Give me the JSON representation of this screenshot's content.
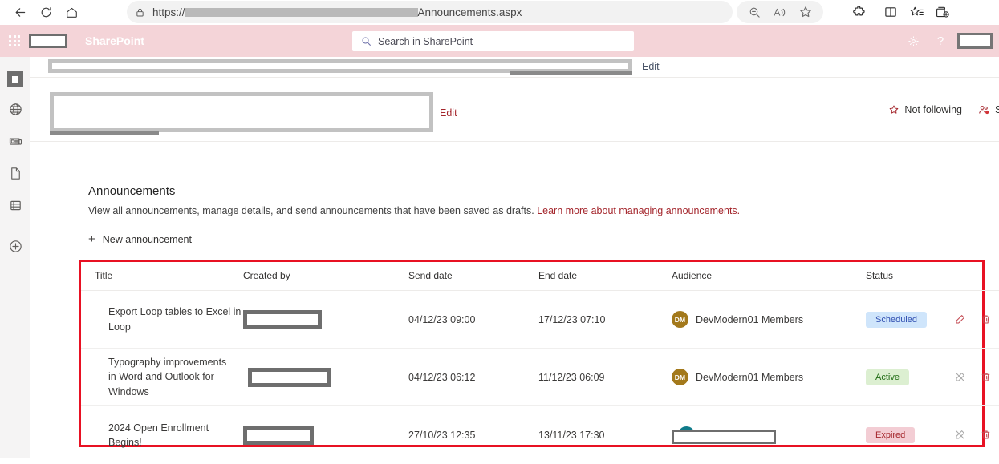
{
  "browser": {
    "url_prefix": "https://",
    "url_suffix": "Announcements.aspx",
    "back_icon": "back-arrow-icon",
    "refresh_icon": "refresh-icon",
    "home_icon": "home-icon",
    "lock_icon": "lock-icon",
    "zoom_out_icon": "zoom-out-icon",
    "read_aloud_icon": "read-aloud-icon",
    "favorite_icon": "star-icon",
    "extensions_icon": "extensions-puzzle-icon",
    "split_screen_icon": "split-screen-icon",
    "collections_icon": "collections-icon",
    "add_tab_icon": "add-tab-icon"
  },
  "suite": {
    "waffle_icon": "app-launcher-waffle-icon",
    "brand": "SharePoint",
    "search_placeholder": "Search in SharePoint",
    "search_icon": "search-icon",
    "settings_icon": "gear-icon",
    "help_label": "?",
    "accent_pink": "#f4d4d8"
  },
  "rail": {
    "items": [
      {
        "name": "home",
        "icon": "home-tile-icon"
      },
      {
        "name": "my-sites",
        "icon": "globe-icon"
      },
      {
        "name": "news",
        "icon": "news-icon"
      },
      {
        "name": "pages",
        "icon": "page-icon"
      },
      {
        "name": "lists",
        "icon": "lists-icon"
      },
      {
        "name": "create",
        "icon": "plus-circle-icon"
      }
    ]
  },
  "site": {
    "edit_nav_label": "Edit",
    "edit_site_label": "Edit",
    "follow_label": "Not following",
    "follow_icon": "star-icon",
    "share_label": "S",
    "share_icon": "people-share-icon"
  },
  "main": {
    "title": "Announcements",
    "description": "View all announcements, manage details, and send announcements that have been saved as drafts.",
    "learn_more": "Learn more about managing announcements.",
    "new_button": "New announcement",
    "new_button_icon": "plus-icon"
  },
  "table": {
    "headers": [
      "Title",
      "Created by",
      "Send date",
      "End date",
      "Audience",
      "Status"
    ],
    "rows": [
      {
        "title": "Export Loop tables to Excel in Loop",
        "created_by": "",
        "send_date": "04/12/23 09:00",
        "end_date": "17/12/23 07:10",
        "audience": "DevModern01 Members",
        "audience_initials": "DM",
        "status": "Scheduled",
        "status_kind": "scheduled",
        "edit_enabled": true,
        "edit_icon": "pencil-icon",
        "delete_icon": "trash-icon"
      },
      {
        "title": "Typography improvements in Word and Outlook for Windows",
        "created_by": "",
        "send_date": "04/12/23 06:12",
        "end_date": "11/12/23 06:09",
        "audience": "DevModern01 Members",
        "audience_initials": "DM",
        "status": "Active",
        "status_kind": "active",
        "edit_enabled": false,
        "edit_icon": "pencil-disabled-icon",
        "delete_icon": "trash-icon"
      },
      {
        "title": "2024 Open Enrollment Begins!",
        "created_by": "",
        "send_date": "27/10/23 12:35",
        "end_date": "13/11/23 17:30",
        "audience": "",
        "audience_initials": "",
        "status": "Expired",
        "status_kind": "expired",
        "edit_enabled": false,
        "edit_icon": "pencil-disabled-icon",
        "delete_icon": "trash-icon"
      }
    ],
    "highlight_color": "#e81123"
  },
  "colors": {
    "badge_scheduled_bg": "#cfe5fb",
    "badge_scheduled_fg": "#2e4db0",
    "badge_active_bg": "#dcefd1",
    "badge_active_fg": "#1f6b13",
    "badge_expired_bg": "#f3cdd4",
    "badge_expired_fg": "#a4262c",
    "avatar_gold": "#a3791b",
    "avatar_teal": "#0f7b8a",
    "link_red": "#a4262c"
  }
}
